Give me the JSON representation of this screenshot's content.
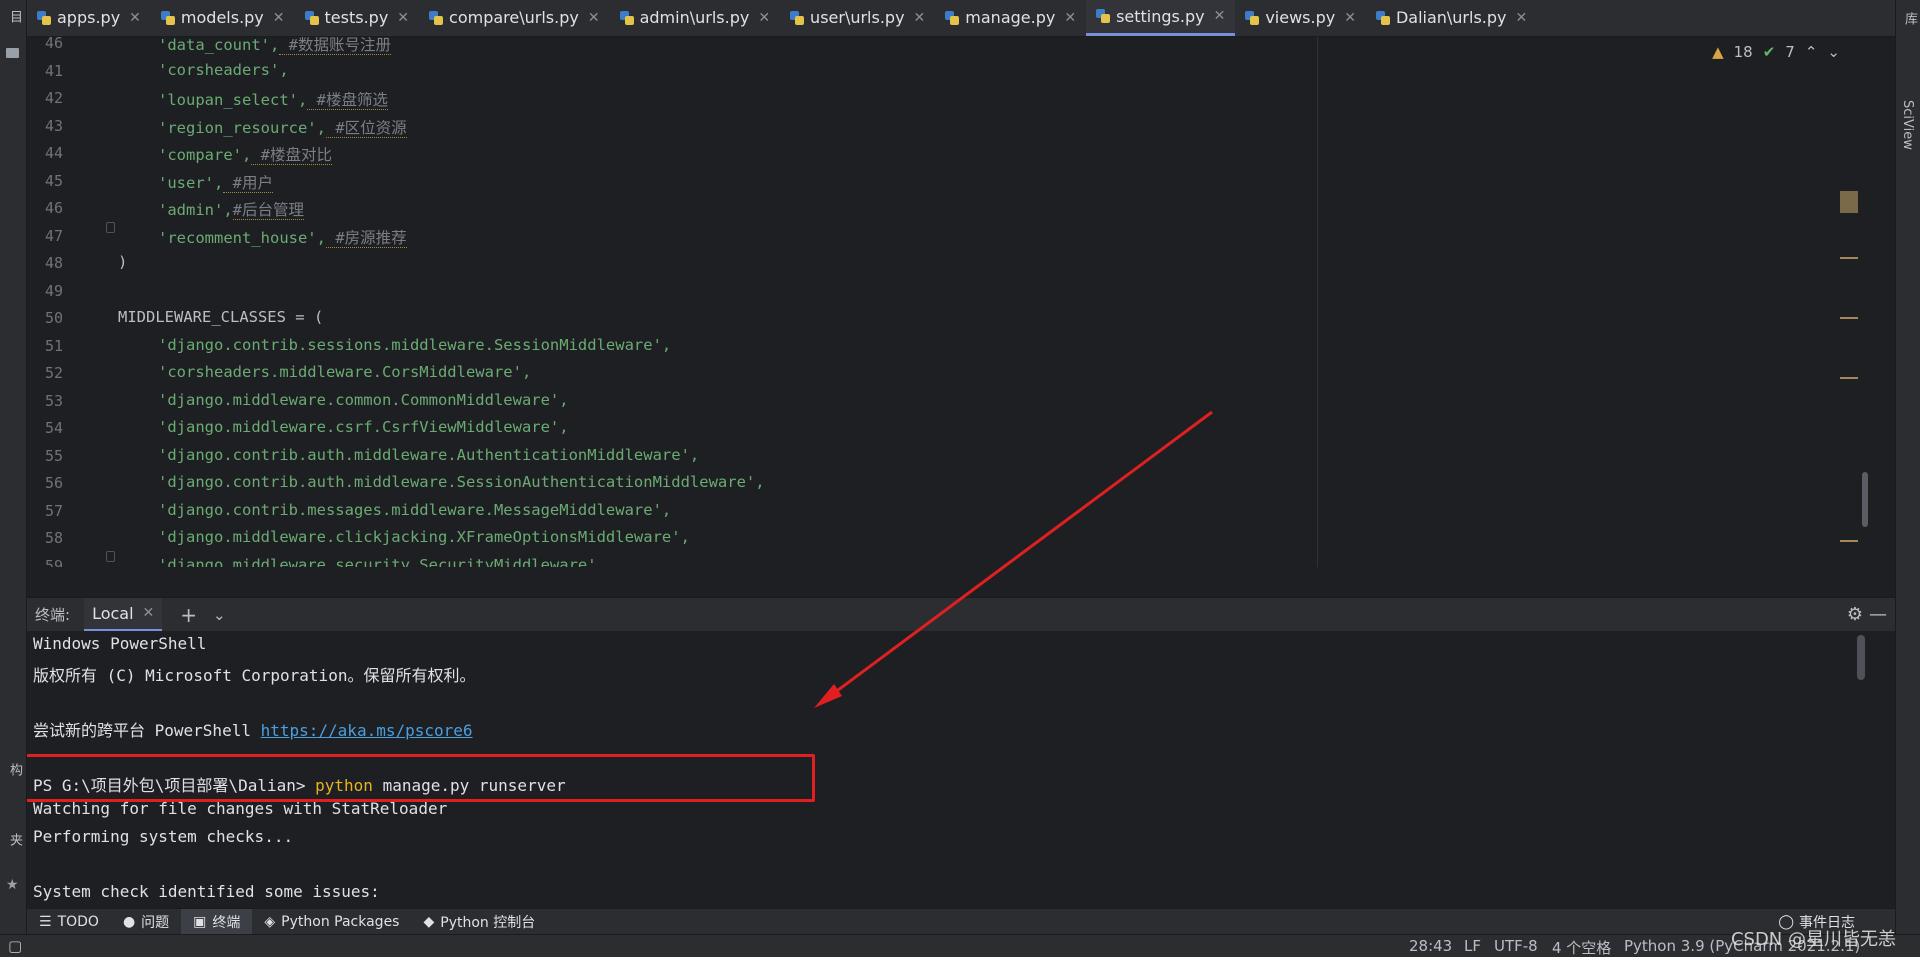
{
  "tabs": [
    {
      "label": "apps.py"
    },
    {
      "label": "models.py"
    },
    {
      "label": "tests.py"
    },
    {
      "label": "compare\\urls.py"
    },
    {
      "label": "admin\\urls.py"
    },
    {
      "label": "user\\urls.py"
    },
    {
      "label": "manage.py"
    },
    {
      "label": "settings.py",
      "active": true
    },
    {
      "label": "views.py"
    },
    {
      "label": "Dalian\\urls.py"
    }
  ],
  "left_strip": {
    "project": "项目",
    "structure": "结构",
    "favorites": "收藏夹"
  },
  "right_strip": {
    "database": "数据库",
    "sciview": "SciView"
  },
  "inspections": {
    "warnings": "18",
    "ok": "7"
  },
  "editor": {
    "lines": [
      {
        "n": "46",
        "s": "'data_count',",
        "c": " #数据账号注册"
      },
      {
        "n": "41",
        "s": "'corsheaders',",
        "c": ""
      },
      {
        "n": "42",
        "s": "'loupan_select',",
        "c": " #楼盘筛选"
      },
      {
        "n": "43",
        "s": "'region_resource',",
        "c": " #区位资源"
      },
      {
        "n": "44",
        "s": "'compare',",
        "c": " #楼盘对比"
      },
      {
        "n": "45",
        "s": "'user',",
        "c": " #用户"
      },
      {
        "n": "46",
        "s": "'admin',",
        "c": "#后台管理"
      },
      {
        "n": "47",
        "s": "'recomment_house',",
        "c": " #房源推荐"
      },
      {
        "n": "48",
        "p": ")"
      },
      {
        "n": "49",
        "p": ""
      },
      {
        "n": "50",
        "p": "MIDDLEWARE_CLASSES = ("
      },
      {
        "n": "51",
        "s": "'django.contrib.sessions.middleware.SessionMiddleware',",
        "c": ""
      },
      {
        "n": "52",
        "s": "'corsheaders.middleware.CorsMiddleware',",
        "c": ""
      },
      {
        "n": "53",
        "s": "'django.middleware.common.CommonMiddleware',",
        "c": ""
      },
      {
        "n": "54",
        "s": "'django.middleware.csrf.CsrfViewMiddleware',",
        "c": ""
      },
      {
        "n": "55",
        "s": "'django.contrib.auth.middleware.AuthenticationMiddleware',",
        "c": ""
      },
      {
        "n": "56",
        "s": "'django.contrib.auth.middleware.SessionAuthenticationMiddleware',",
        "c": ""
      },
      {
        "n": "57",
        "s": "'django.contrib.messages.middleware.MessageMiddleware',",
        "c": ""
      },
      {
        "n": "58",
        "s": "'django.middleware.clickjacking.XFrameOptionsMiddleware',",
        "c": ""
      },
      {
        "n": "59",
        "s": "'django.middleware.security.SecurityMiddleware',",
        "c": ""
      }
    ]
  },
  "terminal": {
    "title": "终端:",
    "tab": "Local",
    "lines": [
      {
        "t": "Windows PowerShell"
      },
      {
        "t": "版权所有 (C) Microsoft Corporation。保留所有权利。"
      },
      {
        "t": ""
      },
      {
        "t": "尝试新的跨平台 PowerShell ",
        "link": "https://aka.ms/pscore6"
      },
      {
        "t": ""
      },
      {
        "t": "PS G:\\项目外包\\项目部署\\Dalian> ",
        "cmd": "python",
        "rest": " manage.py runserver"
      },
      {
        "t": "Watching for file changes with StatReloader"
      },
      {
        "t": "Performing system checks..."
      },
      {
        "t": ""
      },
      {
        "t": "System check identified some issues:"
      }
    ]
  },
  "bottom_tools": [
    {
      "label": "TODO"
    },
    {
      "label": "问题"
    },
    {
      "label": "终端",
      "active": true
    },
    {
      "label": "Python Packages"
    },
    {
      "label": "Python 控制台"
    }
  ],
  "event_log": "事件日志",
  "status": {
    "pos": "28:43",
    "eol": "LF",
    "enc": "UTF-8",
    "indent": "4 个空格",
    "interp": "Python 3.9 (PyCharm 2021.2.1)"
  },
  "watermark": "CSDN @星川皆无恙",
  "colors": {
    "annotation": "#e02020",
    "accent": "#7a8fdb"
  }
}
